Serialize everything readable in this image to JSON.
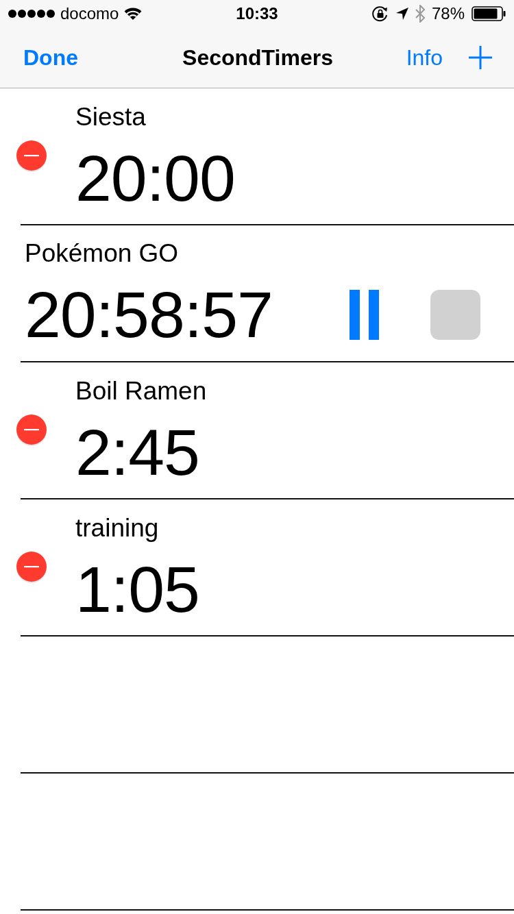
{
  "status_bar": {
    "carrier": "docomo",
    "time": "10:33",
    "battery": "78%"
  },
  "nav_bar": {
    "left_button": "Done",
    "title": "SecondTimers",
    "right_button": "Info"
  },
  "timers": [
    {
      "kind": "editing",
      "name": "Siesta",
      "time": "20:00"
    },
    {
      "kind": "running",
      "name": "Pokémon GO",
      "time": "20:58:57"
    },
    {
      "kind": "editing",
      "name": "Boil Ramen",
      "time": "2:45"
    },
    {
      "kind": "editing",
      "name": "training",
      "time": "1:05"
    }
  ]
}
